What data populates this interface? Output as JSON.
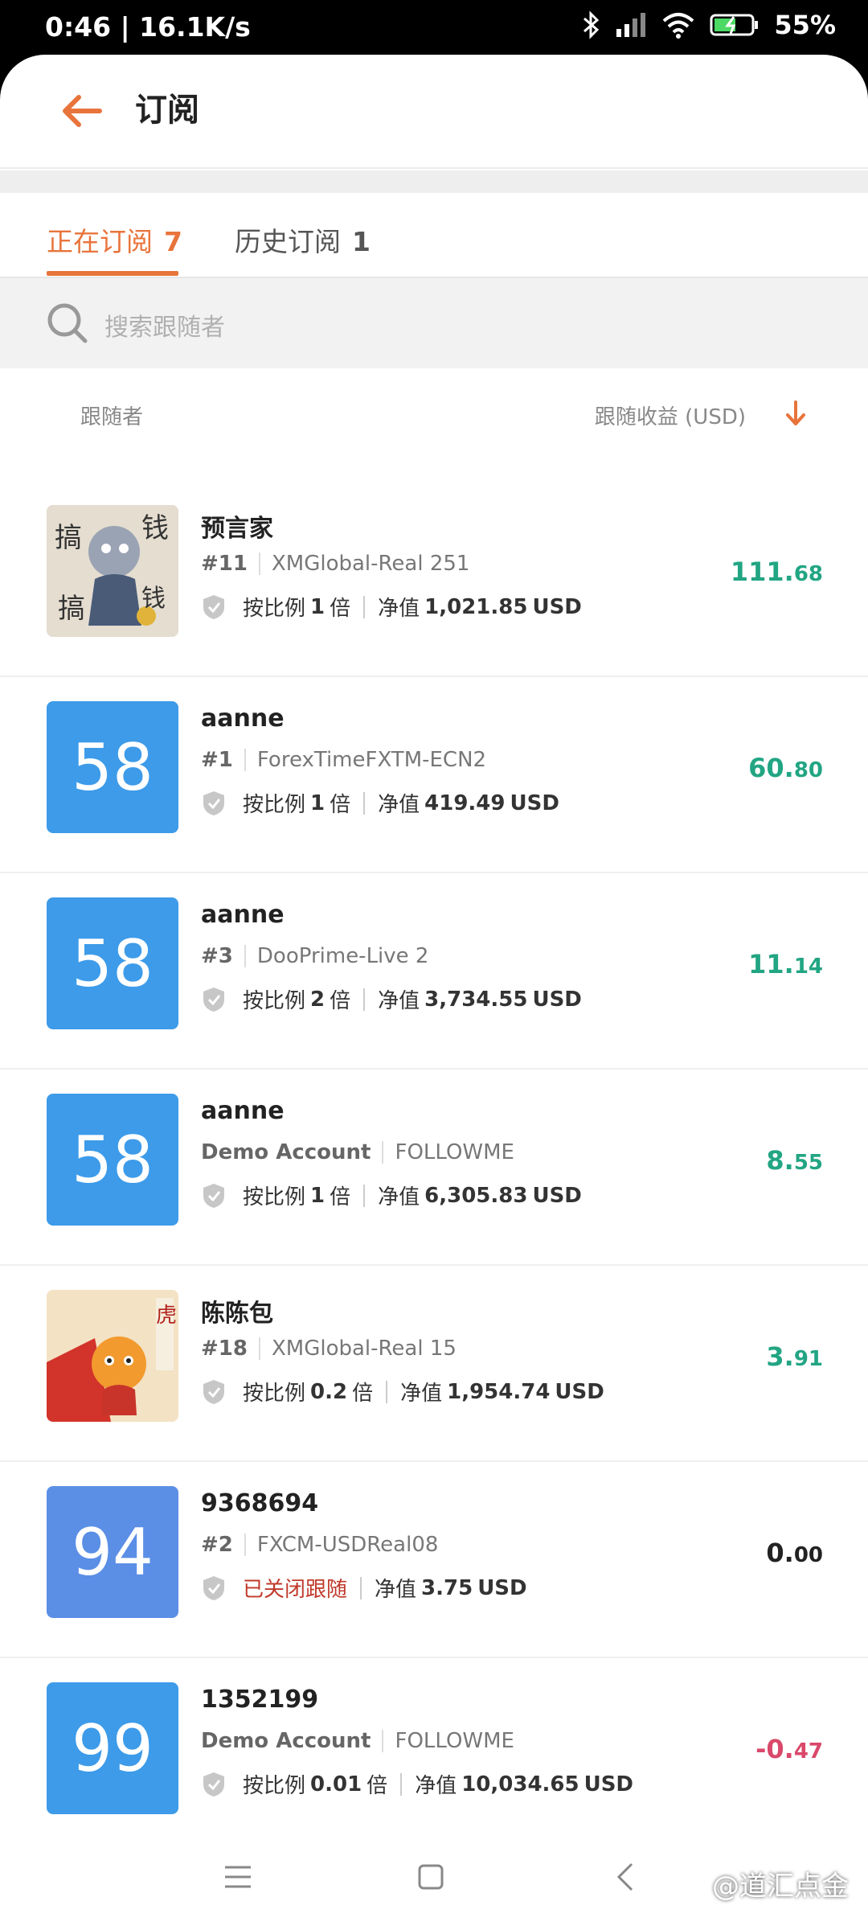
{
  "status_bar": {
    "time": "0:46 | 16.1K/s",
    "battery": "55%"
  },
  "header": {
    "title": "订阅"
  },
  "tabs": [
    {
      "label": "正在订阅",
      "count": "7"
    },
    {
      "label": "历史订阅",
      "count": "1"
    }
  ],
  "search": {
    "placeholder": "搜索跟随者"
  },
  "columns": {
    "left": "跟随者",
    "right": "跟随收益 (USD)"
  },
  "rows": [
    {
      "name": "预言家",
      "rank": "#11",
      "account": "XMGlobal-Real 251",
      "ratio_label": "按比例",
      "ratio": "1",
      "ratio_unit": "倍",
      "equity_label": "净值",
      "equity": "1,021.85",
      "currency": "USD",
      "profit_int": "111.",
      "profit_dec": "68",
      "avatar_type": "image"
    },
    {
      "name": "aanne",
      "rank": "#1",
      "account": "ForexTimeFXTM-ECN2",
      "ratio_label": "按比例",
      "ratio": "1",
      "ratio_unit": "倍",
      "equity_label": "净值",
      "equity": "419.49",
      "currency": "USD",
      "profit_int": "60.",
      "profit_dec": "80",
      "avatar_num": "58"
    },
    {
      "name": "aanne",
      "rank": "#3",
      "account": "DooPrime-Live 2",
      "ratio_label": "按比例",
      "ratio": "2",
      "ratio_unit": "倍",
      "equity_label": "净值",
      "equity": "3,734.55",
      "currency": "USD",
      "profit_int": "11.",
      "profit_dec": "14",
      "avatar_num": "58"
    },
    {
      "name": "aanne",
      "rank": "Demo Account",
      "account": "FOLLOWME",
      "ratio_label": "按比例",
      "ratio": "1",
      "ratio_unit": "倍",
      "equity_label": "净值",
      "equity": "6,305.83",
      "currency": "USD",
      "profit_int": "8.",
      "profit_dec": "55",
      "avatar_num": "58"
    },
    {
      "name": "陈陈包",
      "rank": "#18",
      "account": "XMGlobal-Real 15",
      "ratio_label": "按比例",
      "ratio": "0.2",
      "ratio_unit": "倍",
      "equity_label": "净值",
      "equity": "1,954.74",
      "currency": "USD",
      "profit_int": "3.",
      "profit_dec": "91",
      "avatar_type": "image2"
    },
    {
      "name": "9368694",
      "rank": "#2",
      "account": "FXCM-USDReal08",
      "closed_label": "已关闭跟随",
      "equity_label": "净值",
      "equity": "3.75",
      "currency": "USD",
      "profit_int": "0.",
      "profit_dec": "00",
      "avatar_num": "94"
    },
    {
      "name": "1352199",
      "rank": "Demo Account",
      "account": "FOLLOWME",
      "ratio_label": "按比例",
      "ratio": "0.01",
      "ratio_unit": "倍",
      "equity_label": "净值",
      "equity": "10,034.65",
      "currency": "USD",
      "profit_int": "-0.",
      "profit_dec": "47",
      "avatar_num": "99"
    }
  ],
  "watermark": "@道汇点金",
  "colors": {
    "accent": "#e8743b",
    "positive": "#22a583",
    "negative": "#d9486a",
    "avatar_blue": "#3d9be9"
  }
}
